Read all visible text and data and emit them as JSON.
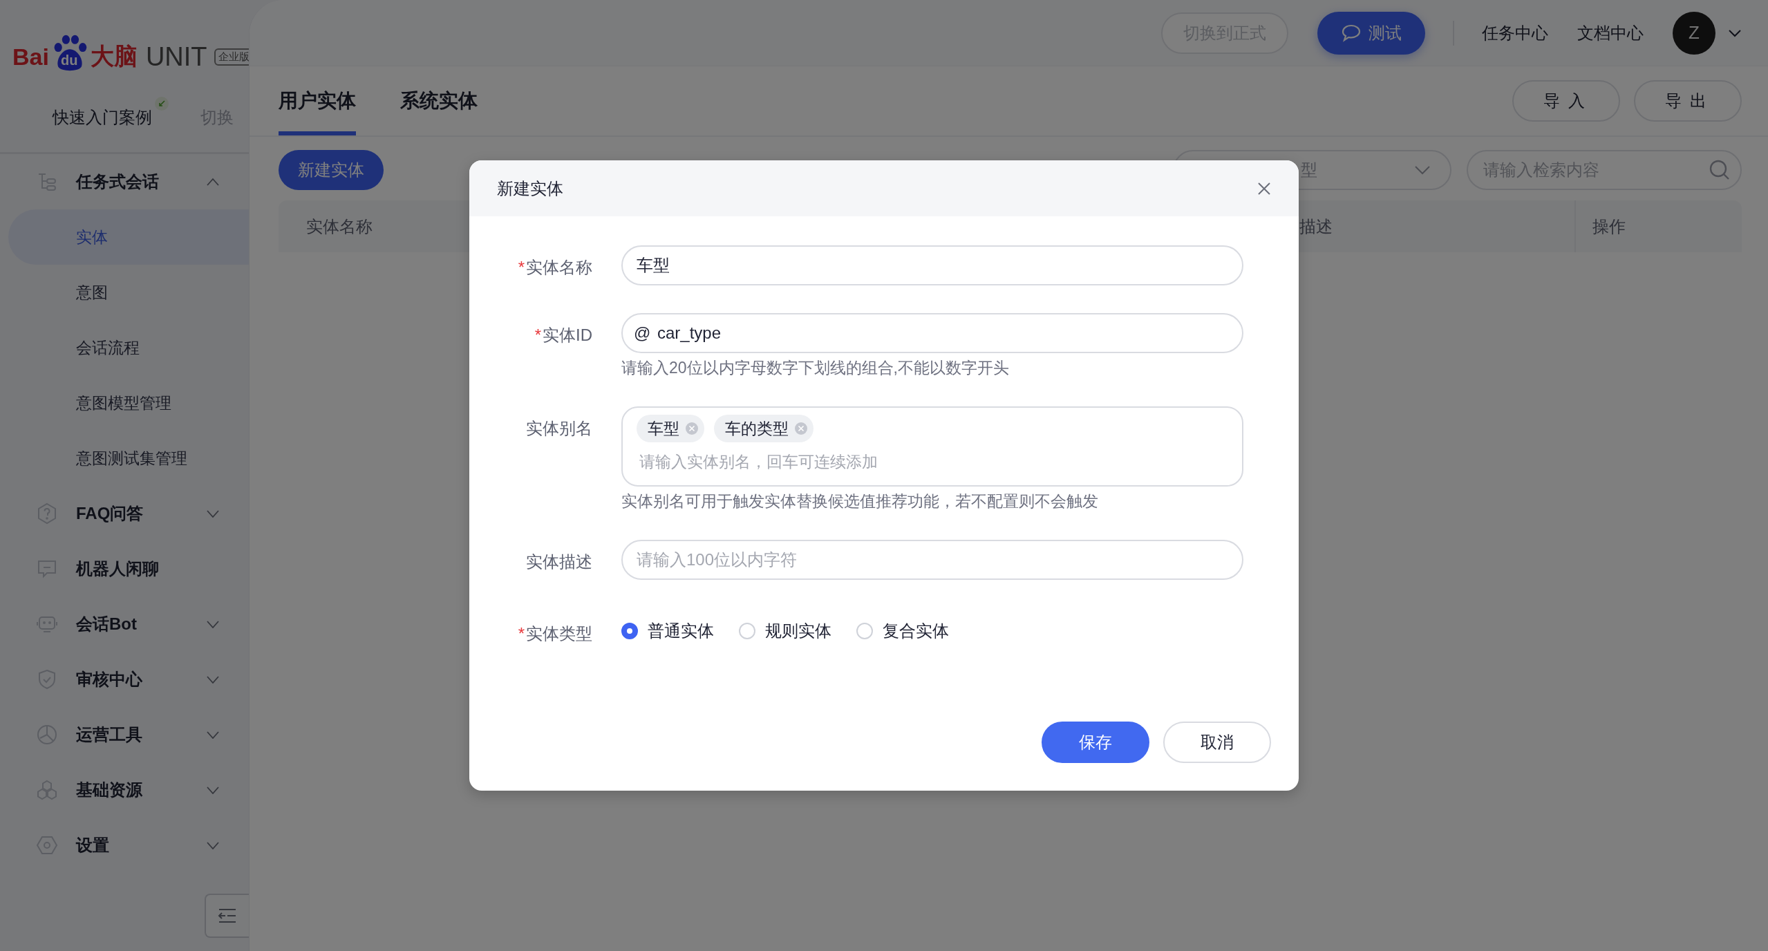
{
  "sidebar": {
    "logo": {
      "brand": "Bai",
      "paw": "du",
      "name": "大脑",
      "product": "UNIT",
      "edition": "企业版"
    },
    "project": {
      "name": "快速入门案例",
      "switch": "切换"
    },
    "menu": [
      {
        "label": "任务式会话",
        "kind": "group",
        "expanded": true,
        "children": [
          {
            "label": "实体",
            "selected": true
          },
          {
            "label": "意图",
            "selected": false
          },
          {
            "label": "会话流程",
            "selected": false
          },
          {
            "label": "意图模型管理",
            "selected": false
          },
          {
            "label": "意图测试集管理",
            "selected": false
          }
        ]
      },
      {
        "label": "FAQ问答",
        "kind": "group",
        "expanded": false
      },
      {
        "label": "机器人闲聊",
        "kind": "link"
      },
      {
        "label": "会话Bot",
        "kind": "group",
        "expanded": false
      },
      {
        "label": "审核中心",
        "kind": "group",
        "expanded": false
      },
      {
        "label": "运营工具",
        "kind": "group",
        "expanded": false
      },
      {
        "label": "基础资源",
        "kind": "group",
        "expanded": false
      },
      {
        "label": "设置",
        "kind": "group",
        "expanded": false
      }
    ]
  },
  "topbar": {
    "switch_button": "切换到正式",
    "test_button": "测试",
    "links": [
      "任务中心",
      "文档中心"
    ],
    "avatar": "Z"
  },
  "tabs": [
    {
      "label": "用户实体",
      "selected": true
    },
    {
      "label": "系统实体",
      "selected": false
    }
  ],
  "actions": [
    "导入",
    "导出"
  ],
  "toolbar": {
    "new_button": "新建实体",
    "type_select": "型",
    "search": {
      "placeholder": "请输入检索内容"
    }
  },
  "table": {
    "columns": [
      "实体名称",
      "描述",
      "操作"
    ]
  },
  "dialog": {
    "title": "新建实体",
    "fields": [
      {
        "kind": "text",
        "label": "实体名称",
        "mark": "*",
        "value": "车型"
      },
      {
        "kind": "id",
        "label": "实体ID",
        "mark": "*",
        "prefix": "@",
        "value": "car_type",
        "hint": "请输入20位以内字母数字下划线的组合,不能以数字开头"
      },
      {
        "kind": "tags",
        "label": "实体别名",
        "tags": [
          "车型",
          "车的类型"
        ],
        "placeholder": "请输入实体别名，回车可连续添加",
        "hint": "实体别名可用于触发实体替换候选值推荐功能，若不配置则不会触发"
      },
      {
        "kind": "text",
        "label": "实体描述",
        "placeholder": "请输入100位以内字符"
      },
      {
        "kind": "radio",
        "label": "实体类型",
        "mark": "*",
        "options": [
          {
            "label": "普通实体",
            "selected": true
          },
          {
            "label": "规则实体",
            "selected": false
          },
          {
            "label": "复合实体",
            "selected": false
          }
        ]
      }
    ],
    "buttons": [
      "保存",
      "取消"
    ]
  }
}
